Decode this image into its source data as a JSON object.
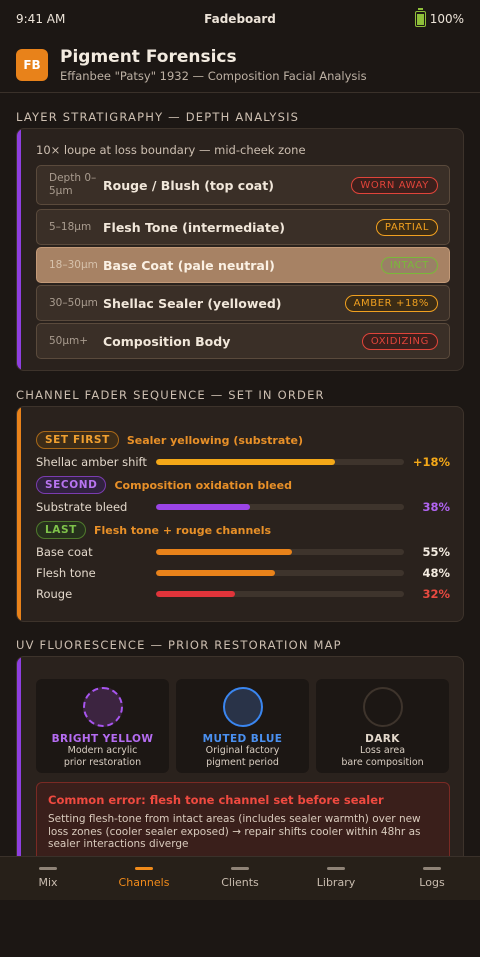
{
  "status_bar": {
    "time": "9:41 AM",
    "carrier": "Fadeboard",
    "battery": "100%"
  },
  "header": {
    "logo_text": "FB",
    "title": "Pigment Forensics",
    "subtitle": "Effanbee \"Patsy\" 1932 — Composition Facial Analysis"
  },
  "stratigraphy": {
    "section_title": "LAYER STRATIGRAPHY — DEPTH ANALYSIS",
    "note": "10× loupe at loss boundary — mid-cheek zone",
    "layers": [
      {
        "depth": "Depth 0–5μm",
        "name": "Rouge / Blush (top coat)",
        "status": "WORN AWAY"
      },
      {
        "depth": "5–18μm",
        "name": "Flesh Tone (intermediate)",
        "status": "PARTIAL"
      },
      {
        "depth": "18–30μm",
        "name": "Base Coat (pale neutral)",
        "status": "INTACT"
      },
      {
        "depth": "30–50μm",
        "name": "Shellac Sealer (yellowed)",
        "status": "AMBER +18%"
      },
      {
        "depth": "50μm+",
        "name": "Composition Body",
        "status": "OXIDIZING"
      }
    ]
  },
  "faders": {
    "section_title": "CHANNEL FADER SEQUENCE — SET IN ORDER",
    "steps": [
      {
        "pill": "SET FIRST",
        "desc": "Sealer yellowing (substrate)"
      },
      {
        "pill": "SECOND",
        "desc": "Composition oxidation bleed"
      },
      {
        "pill": "LAST",
        "desc": "Flesh tone + rouge channels"
      }
    ],
    "channels": [
      {
        "label": "Shellac amber shift",
        "value": "+18%",
        "level": 0.72
      },
      {
        "label": "Substrate bleed",
        "value": "38%",
        "level": 0.38
      },
      {
        "label": "Base coat",
        "value": "55%",
        "level": 0.55
      },
      {
        "label": "Flesh tone",
        "value": "48%",
        "level": 0.48
      },
      {
        "label": "Rouge",
        "value": "32%",
        "level": 0.32
      }
    ]
  },
  "uv": {
    "section_title": "UV FLUORESCENCE — PRIOR RESTORATION MAP",
    "tiles": [
      {
        "name": "BRIGHT YELLOW",
        "line1": "Modern acrylic",
        "line2": "prior restoration"
      },
      {
        "name": "MUTED BLUE",
        "line1": "Original factory",
        "line2": "pigment period"
      },
      {
        "name": "DARK",
        "line1": "Loss area",
        "line2": "bare composition"
      }
    ],
    "warning_title": "Common error: flesh tone channel set before sealer",
    "warning_body": "Setting flesh-tone from intact areas (includes sealer warmth) over new loss zones (cooler sealer exposed) → repair shifts cooler within 48hr as sealer interactions diverge"
  },
  "tabs": [
    {
      "label": "Mix"
    },
    {
      "label": "Channels"
    },
    {
      "label": "Clients"
    },
    {
      "label": "Library"
    },
    {
      "label": "Logs"
    }
  ],
  "colors": {
    "accent_orange": "#e8821a",
    "accent_purple": "#8e3fe0",
    "danger_red": "#e0443a"
  }
}
